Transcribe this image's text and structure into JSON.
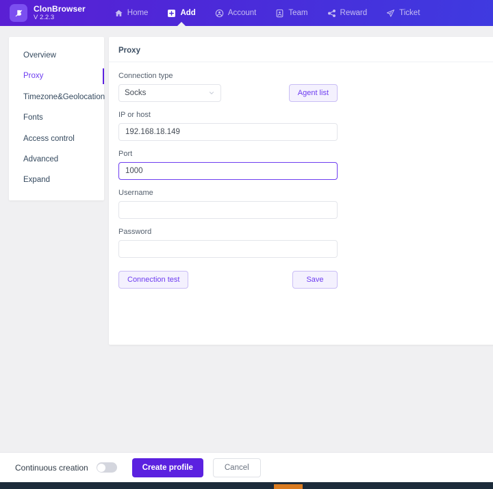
{
  "header": {
    "brand_name": "ClonBrowser",
    "brand_version": "V 2.2.3",
    "logo_icon": "clonbrowser-logo-icon",
    "nav": [
      {
        "label": "Home",
        "icon": "home-icon",
        "active": false
      },
      {
        "label": "Add",
        "icon": "plus-square-icon",
        "active": true
      },
      {
        "label": "Account",
        "icon": "account-circle-icon",
        "active": false
      },
      {
        "label": "Team",
        "icon": "team-card-icon",
        "active": false
      },
      {
        "label": "Reward",
        "icon": "share-icon",
        "active": false
      },
      {
        "label": "Ticket",
        "icon": "paper-plane-icon",
        "active": false
      }
    ]
  },
  "sidebar": {
    "items": [
      {
        "label": "Overview",
        "active": false
      },
      {
        "label": "Proxy",
        "active": true
      },
      {
        "label": "Timezone&Geolocation",
        "active": false
      },
      {
        "label": "Fonts",
        "active": false
      },
      {
        "label": "Access control",
        "active": false
      },
      {
        "label": "Advanced",
        "active": false
      },
      {
        "label": "Expand",
        "active": false
      }
    ]
  },
  "panel": {
    "title": "Proxy",
    "connection_type": {
      "label": "Connection type",
      "value": "Socks",
      "chevron_icon": "chevron-down-icon"
    },
    "agent_list_button": "Agent list",
    "ip_or_host": {
      "label": "IP or host",
      "value": "192.168.18.149",
      "placeholder": ""
    },
    "port": {
      "label": "Port",
      "value": "1000",
      "placeholder": "",
      "focused": true
    },
    "username": {
      "label": "Username",
      "value": "",
      "placeholder": ""
    },
    "password": {
      "label": "Password",
      "value": "",
      "placeholder": ""
    },
    "connection_test_button": "Connection test",
    "save_button": "Save"
  },
  "footer": {
    "continuous_creation_label": "Continuous creation",
    "continuous_creation_on": false,
    "create_profile_button": "Create profile",
    "cancel_button": "Cancel"
  },
  "colors": {
    "brand_purple": "#5b21e0",
    "header_gradient_start": "#5a1fd4",
    "header_gradient_end": "#3f3ae0",
    "accent_link": "#6d3cf0",
    "page_background": "#f0f0f2",
    "taskbar": "#1c2b3a",
    "taskbar_active": "#d97b21"
  }
}
